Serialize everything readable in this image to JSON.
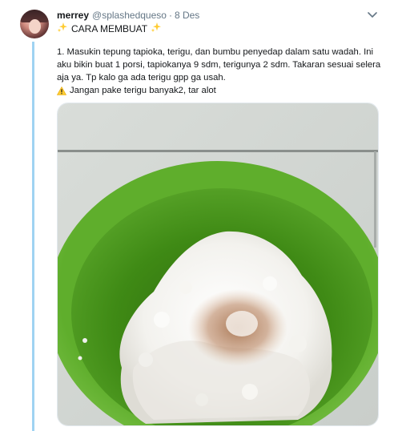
{
  "tweet": {
    "display_name": "merrey",
    "handle": "@splashedqueso",
    "separator": "·",
    "time": "8 Des",
    "title_text": "CARA MEMBUAT",
    "body_line_1": "1. Masukin tepung tapioka, terigu, dan bumbu penyedap dalam satu wadah. Ini aku bikin buat 1 porsi, tapiokanya 9 sdm, terigunya 2 sdm. Takaran sesuai selera aja ya. Tp kalo ga ada terigu gpp ga usah.",
    "warning_text": "Jangan pake terigu banyak2, tar alot"
  },
  "icons": {
    "title_icon": "sparkles-icon",
    "warning_icon": "warning-icon",
    "menu_icon": "chevron-down-icon"
  },
  "colors": {
    "thread_line": "#9fd3f2",
    "bowl_green": "#4e9a1c",
    "muted_text": "#657786"
  }
}
